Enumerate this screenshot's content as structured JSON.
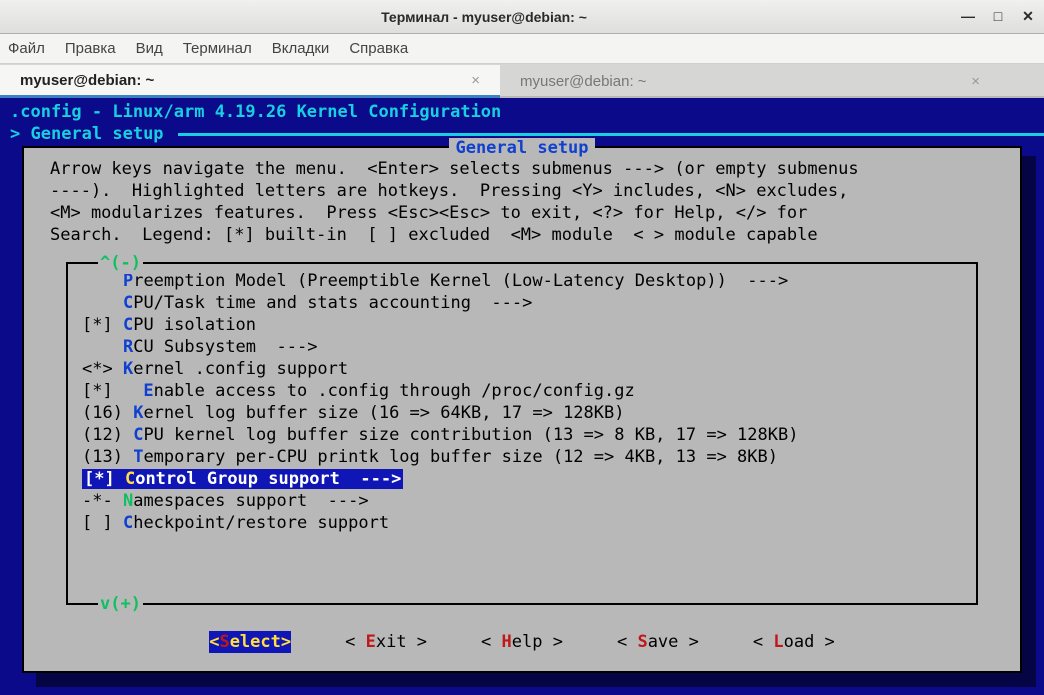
{
  "window": {
    "title": "Терминал - myuser@debian: ~",
    "min": "—",
    "max": "□",
    "close": "✕"
  },
  "menubar": [
    "Файл",
    "Правка",
    "Вид",
    "Терминал",
    "Вкладки",
    "Справка"
  ],
  "tabs": [
    {
      "label": "myuser@debian: ~",
      "active": true
    },
    {
      "label": "myuser@debian: ~",
      "active": false
    }
  ],
  "config_header": ".config - Linux/arm 4.19.26 Kernel Configuration",
  "breadcrumb_prefix": "> ",
  "breadcrumb": "General setup",
  "box_title": "General setup",
  "help_text": "Arrow keys navigate the menu.  <Enter> selects submenus ---> (or empty submenus\n----).  Highlighted letters are hotkeys.  Pressing <Y> includes, <N> excludes,\n<M> modularizes features.  Press <Esc><Esc> to exit, <?> for Help, </> for\nSearch.  Legend: [*] built-in  [ ] excluded  <M> module  < > module capable",
  "scroll_up": "^(-)",
  "scroll_down": "v(+)",
  "items": [
    {
      "prefix": "    ",
      "hk": "P",
      "rest": "reemption Model (Preemptible Kernel (Low-Latency Desktop))  --->",
      "selected": false
    },
    {
      "prefix": "    ",
      "hk": "C",
      "rest": "PU/Task time and stats accounting  --->",
      "selected": false
    },
    {
      "prefix": "[*] ",
      "hk": "C",
      "rest": "PU isolation",
      "selected": false
    },
    {
      "prefix": "    ",
      "hk": "R",
      "rest": "CU Subsystem  --->",
      "selected": false
    },
    {
      "prefix": "<*> ",
      "hk": "K",
      "rest": "ernel .config support",
      "selected": false
    },
    {
      "prefix": "[*]   ",
      "hk": "E",
      "rest": "nable access to .config through /proc/config.gz",
      "selected": false
    },
    {
      "prefix": "(16) ",
      "hk": "K",
      "rest": "ernel log buffer size (16 => 64KB, 17 => 128KB)",
      "selected": false
    },
    {
      "prefix": "(12) ",
      "hk": "C",
      "rest": "PU kernel log buffer size contribution (13 => 8 KB, 17 => 128KB)",
      "selected": false
    },
    {
      "prefix": "(13) ",
      "hk": "T",
      "rest": "emporary per-CPU printk log buffer size (12 => 4KB, 13 => 8KB)",
      "selected": false
    },
    {
      "prefix": "[*] ",
      "hk": "C",
      "rest": "ontrol Group support  --->",
      "selected": true
    },
    {
      "prefix": "-*- ",
      "hk": "N",
      "rest": "amespaces support  --->",
      "selected": false,
      "hk_color": "#10c060"
    },
    {
      "prefix": "[ ] ",
      "hk": "C",
      "rest": "heckpoint/restore support",
      "selected": false
    }
  ],
  "buttons": [
    {
      "pre": "<",
      "hk": "S",
      "rest": "elect>",
      "selected": true
    },
    {
      "pre": "< ",
      "hk": "E",
      "rest": "xit >",
      "selected": false
    },
    {
      "pre": "< ",
      "hk": "H",
      "rest": "elp >",
      "selected": false
    },
    {
      "pre": "< ",
      "hk": "S",
      "rest": "ave >",
      "selected": false
    },
    {
      "pre": "< ",
      "hk": "L",
      "rest": "oad >",
      "selected": false
    }
  ]
}
